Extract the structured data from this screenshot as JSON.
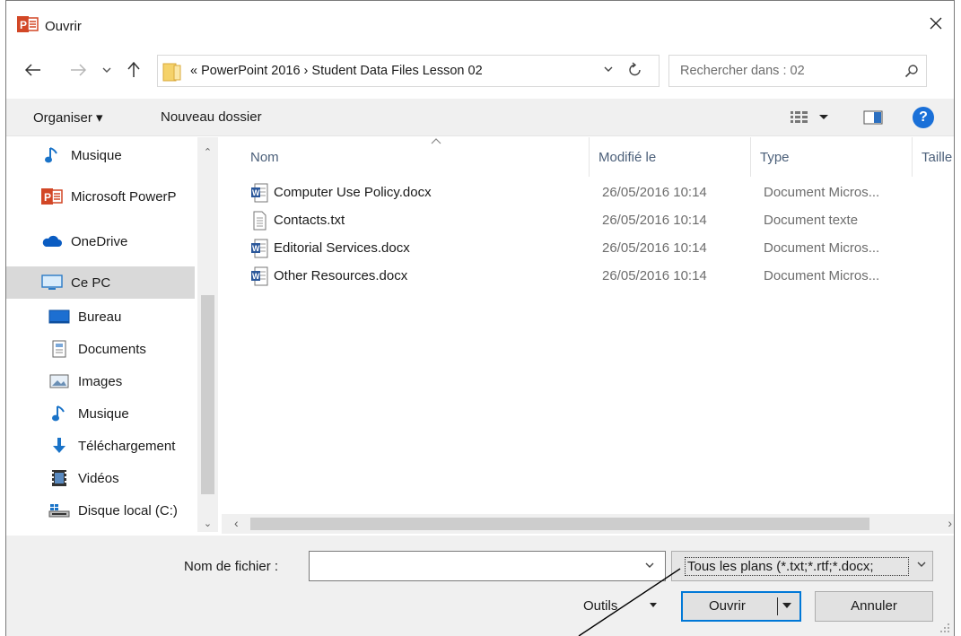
{
  "window": {
    "title": "Ouvrir"
  },
  "address": {
    "path": "« PowerPoint 2016 › Student Data Files Lesson 02"
  },
  "search": {
    "placeholder": "Rechercher dans : 02"
  },
  "toolbar": {
    "organize": "Organiser ▾",
    "new_folder": "Nouveau dossier",
    "help": "?"
  },
  "sidebar": {
    "items": [
      {
        "label": "Musique",
        "icon": "music-note-icon"
      },
      {
        "label": "Microsoft PowerP",
        "icon": "powerpoint-icon"
      },
      {
        "label": "OneDrive",
        "icon": "cloud-icon"
      },
      {
        "label": "Ce PC",
        "icon": "computer-icon",
        "selected": true
      },
      {
        "label": "Bureau",
        "icon": "desktop-icon"
      },
      {
        "label": "Documents",
        "icon": "documents-icon"
      },
      {
        "label": "Images",
        "icon": "images-icon"
      },
      {
        "label": "Musique",
        "icon": "music-note-icon"
      },
      {
        "label": "Téléchargement",
        "icon": "download-icon"
      },
      {
        "label": "Vidéos",
        "icon": "video-icon"
      },
      {
        "label": "Disque local (C:)",
        "icon": "drive-icon"
      }
    ]
  },
  "filelist": {
    "columns": [
      "Nom",
      "Modifié le",
      "Type",
      "Taille"
    ],
    "rows": [
      {
        "name": "Computer Use Policy.docx",
        "date": "26/05/2016 10:14",
        "type": "Document Micros...",
        "icon": "word-doc-icon"
      },
      {
        "name": "Contacts.txt",
        "date": "26/05/2016 10:14",
        "type": "Document texte",
        "icon": "text-file-icon"
      },
      {
        "name": "Editorial Services.docx",
        "date": "26/05/2016 10:14",
        "type": "Document Micros...",
        "icon": "word-doc-icon"
      },
      {
        "name": "Other Resources.docx",
        "date": "26/05/2016 10:14",
        "type": "Document Micros...",
        "icon": "word-doc-icon"
      }
    ]
  },
  "bottom": {
    "filename_label": "Nom de fichier :",
    "filename_value": "",
    "filter": "Tous les plans (*.txt;*.rtf;*.docx;",
    "tools": "Outils",
    "open": "Ouvrir",
    "cancel": "Annuler"
  },
  "colors": {
    "accent": "#0078d7",
    "selected": "#d9d9d9",
    "panel": "#f0f0f0",
    "header_text": "#4c607a"
  }
}
